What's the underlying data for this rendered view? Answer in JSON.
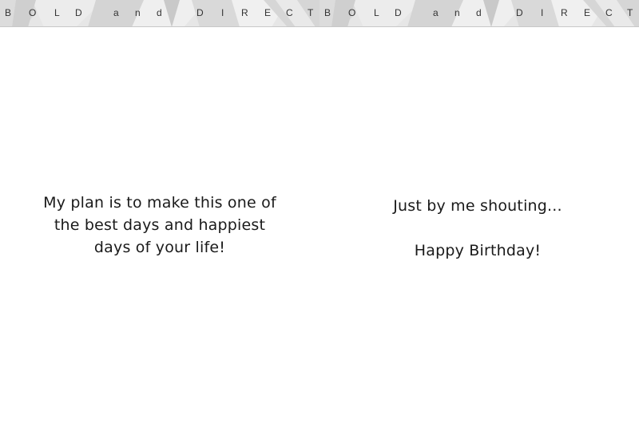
{
  "banner": {
    "letters": [
      "B",
      "O",
      "L",
      "D",
      "a",
      "n",
      "d",
      "D",
      "I",
      "R",
      "E",
      "C",
      "T"
    ]
  },
  "left_panel": {
    "lines": [
      "My plan is to make this one of",
      "the best days and happiest",
      "days of your life!"
    ]
  },
  "right_panel": {
    "line1": "Just by me shouting...",
    "line2": "Happy Birthday!"
  }
}
